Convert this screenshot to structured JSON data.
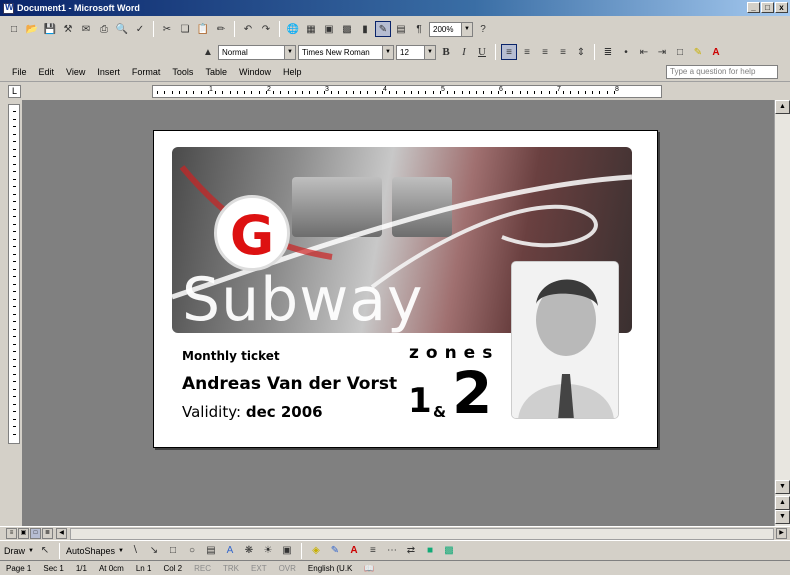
{
  "window": {
    "title": "Document1 - Microsoft Word",
    "controls": [
      "_",
      "□",
      "x"
    ]
  },
  "toolbar": {
    "zoom": "200%",
    "style": "Normal",
    "font": "Times New Roman",
    "size": "12",
    "bold": "B",
    "italic": "I",
    "underline": "U"
  },
  "menu": {
    "items": [
      "File",
      "Edit",
      "View",
      "Insert",
      "Format",
      "Tools",
      "Table",
      "Window",
      "Help"
    ],
    "ask_placeholder": "Type a question for help"
  },
  "ruler": {
    "numbers": [
      "1",
      "2",
      "3",
      "4",
      "5",
      "6",
      "7",
      "8"
    ]
  },
  "card": {
    "brand": "Subway",
    "logo_letter": "G",
    "ticket_type": "Monthly ticket",
    "holder": "Andreas Van der Vorst",
    "validity_label": "Validity:",
    "validity_value": "dec 2006",
    "zones_label": "zones",
    "zone_a": "1",
    "zone_amp": "&",
    "zone_b": "2"
  },
  "drawbar": {
    "draw": "Draw",
    "autoshapes": "AutoShapes"
  },
  "status": {
    "page": "Page 1",
    "sec": "Sec 1",
    "pages": "1/1",
    "at": "At 0cm",
    "ln": "Ln 1",
    "col": "Col 2",
    "rec": "REC",
    "trk": "TRK",
    "ext": "EXT",
    "ovr": "OVR",
    "lang": "English (U.K"
  },
  "colors": {
    "logo_red": "#dd1111",
    "titlebar": "#0a246a",
    "workspace": "#808080"
  }
}
